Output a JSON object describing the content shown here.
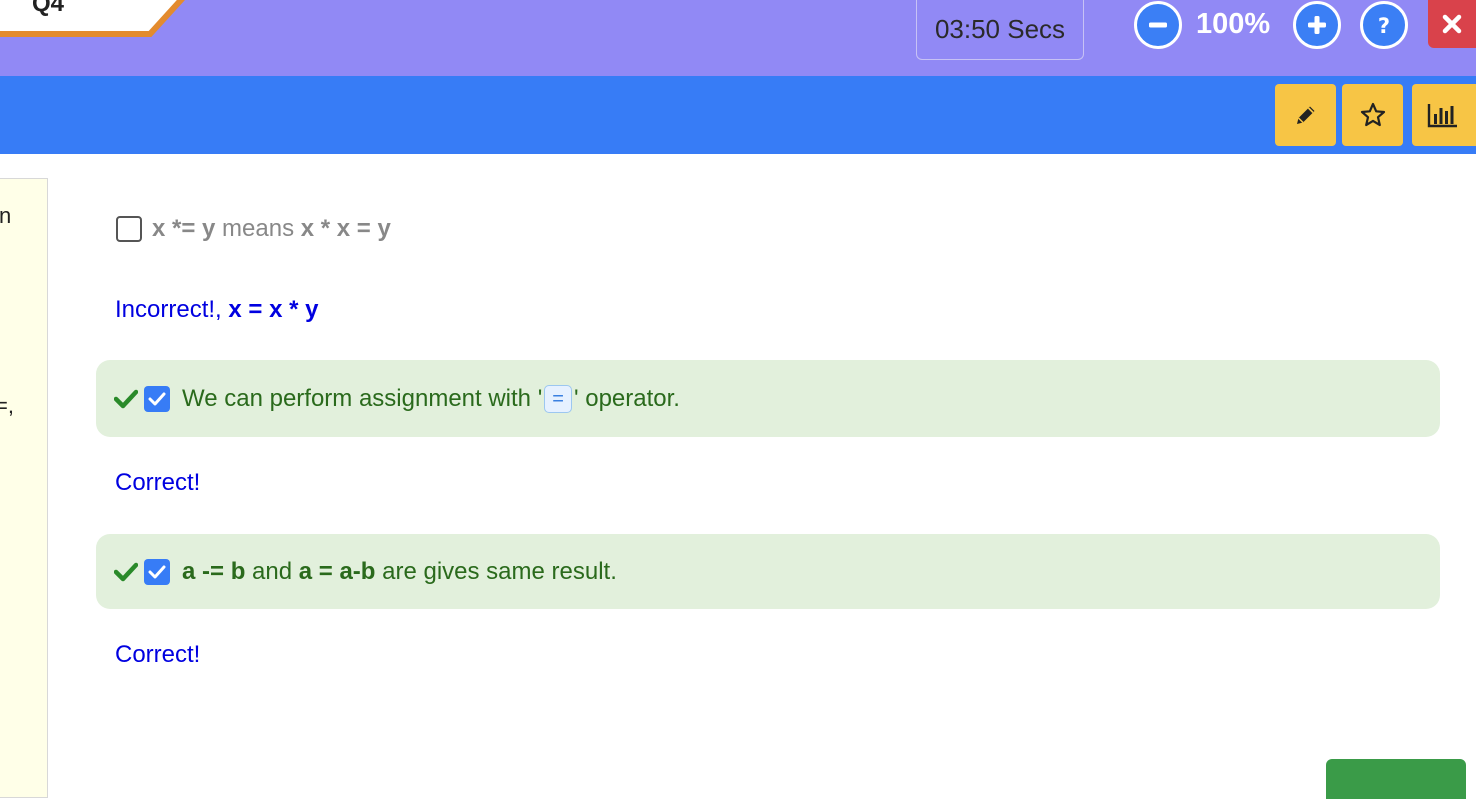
{
  "header": {
    "question_label": "Q4",
    "timer_text": "03:50 Secs",
    "zoom_level": "100%"
  },
  "left_panel": {
    "fragments": [
      "n",
      "=,"
    ]
  },
  "options": [
    {
      "state": "unchecked",
      "parts": [
        {
          "text": "x *= y",
          "bold": true
        },
        {
          "text": " means ",
          "bold": false
        },
        {
          "text": "x * x = y",
          "bold": true
        }
      ],
      "feedback": {
        "plain": "Incorrect!, ",
        "bold": "x = x * y"
      }
    },
    {
      "state": "checked-correct",
      "before": "We can perform assignment with '",
      "code": "=",
      "after": "' operator.",
      "feedback": {
        "plain": "Correct!"
      }
    },
    {
      "state": "checked-correct",
      "parts": [
        {
          "text": "a -= b",
          "bold": true
        },
        {
          "text": " and ",
          "bold": false
        },
        {
          "text": "a = a-b",
          "bold": true
        },
        {
          "text": " are gives same result.",
          "bold": false
        }
      ],
      "feedback": {
        "plain": "Correct!"
      }
    }
  ],
  "colors": {
    "header_bg": "#9189f5",
    "toolbar_bg": "#377cf6",
    "tool_button": "#f7c545",
    "close_button": "#d9424b",
    "correct_bg": "#e2f0dc",
    "correct_text": "#2a6a1c",
    "feedback_text": "#0000e0"
  },
  "icons": {
    "zoom_out": "minus-circle-icon",
    "zoom_in": "plus-circle-icon",
    "help": "question-circle-icon",
    "close": "close-icon",
    "edit": "pencil-icon",
    "bookmark": "star-icon",
    "stats": "bar-chart-icon",
    "correct": "check-icon"
  }
}
